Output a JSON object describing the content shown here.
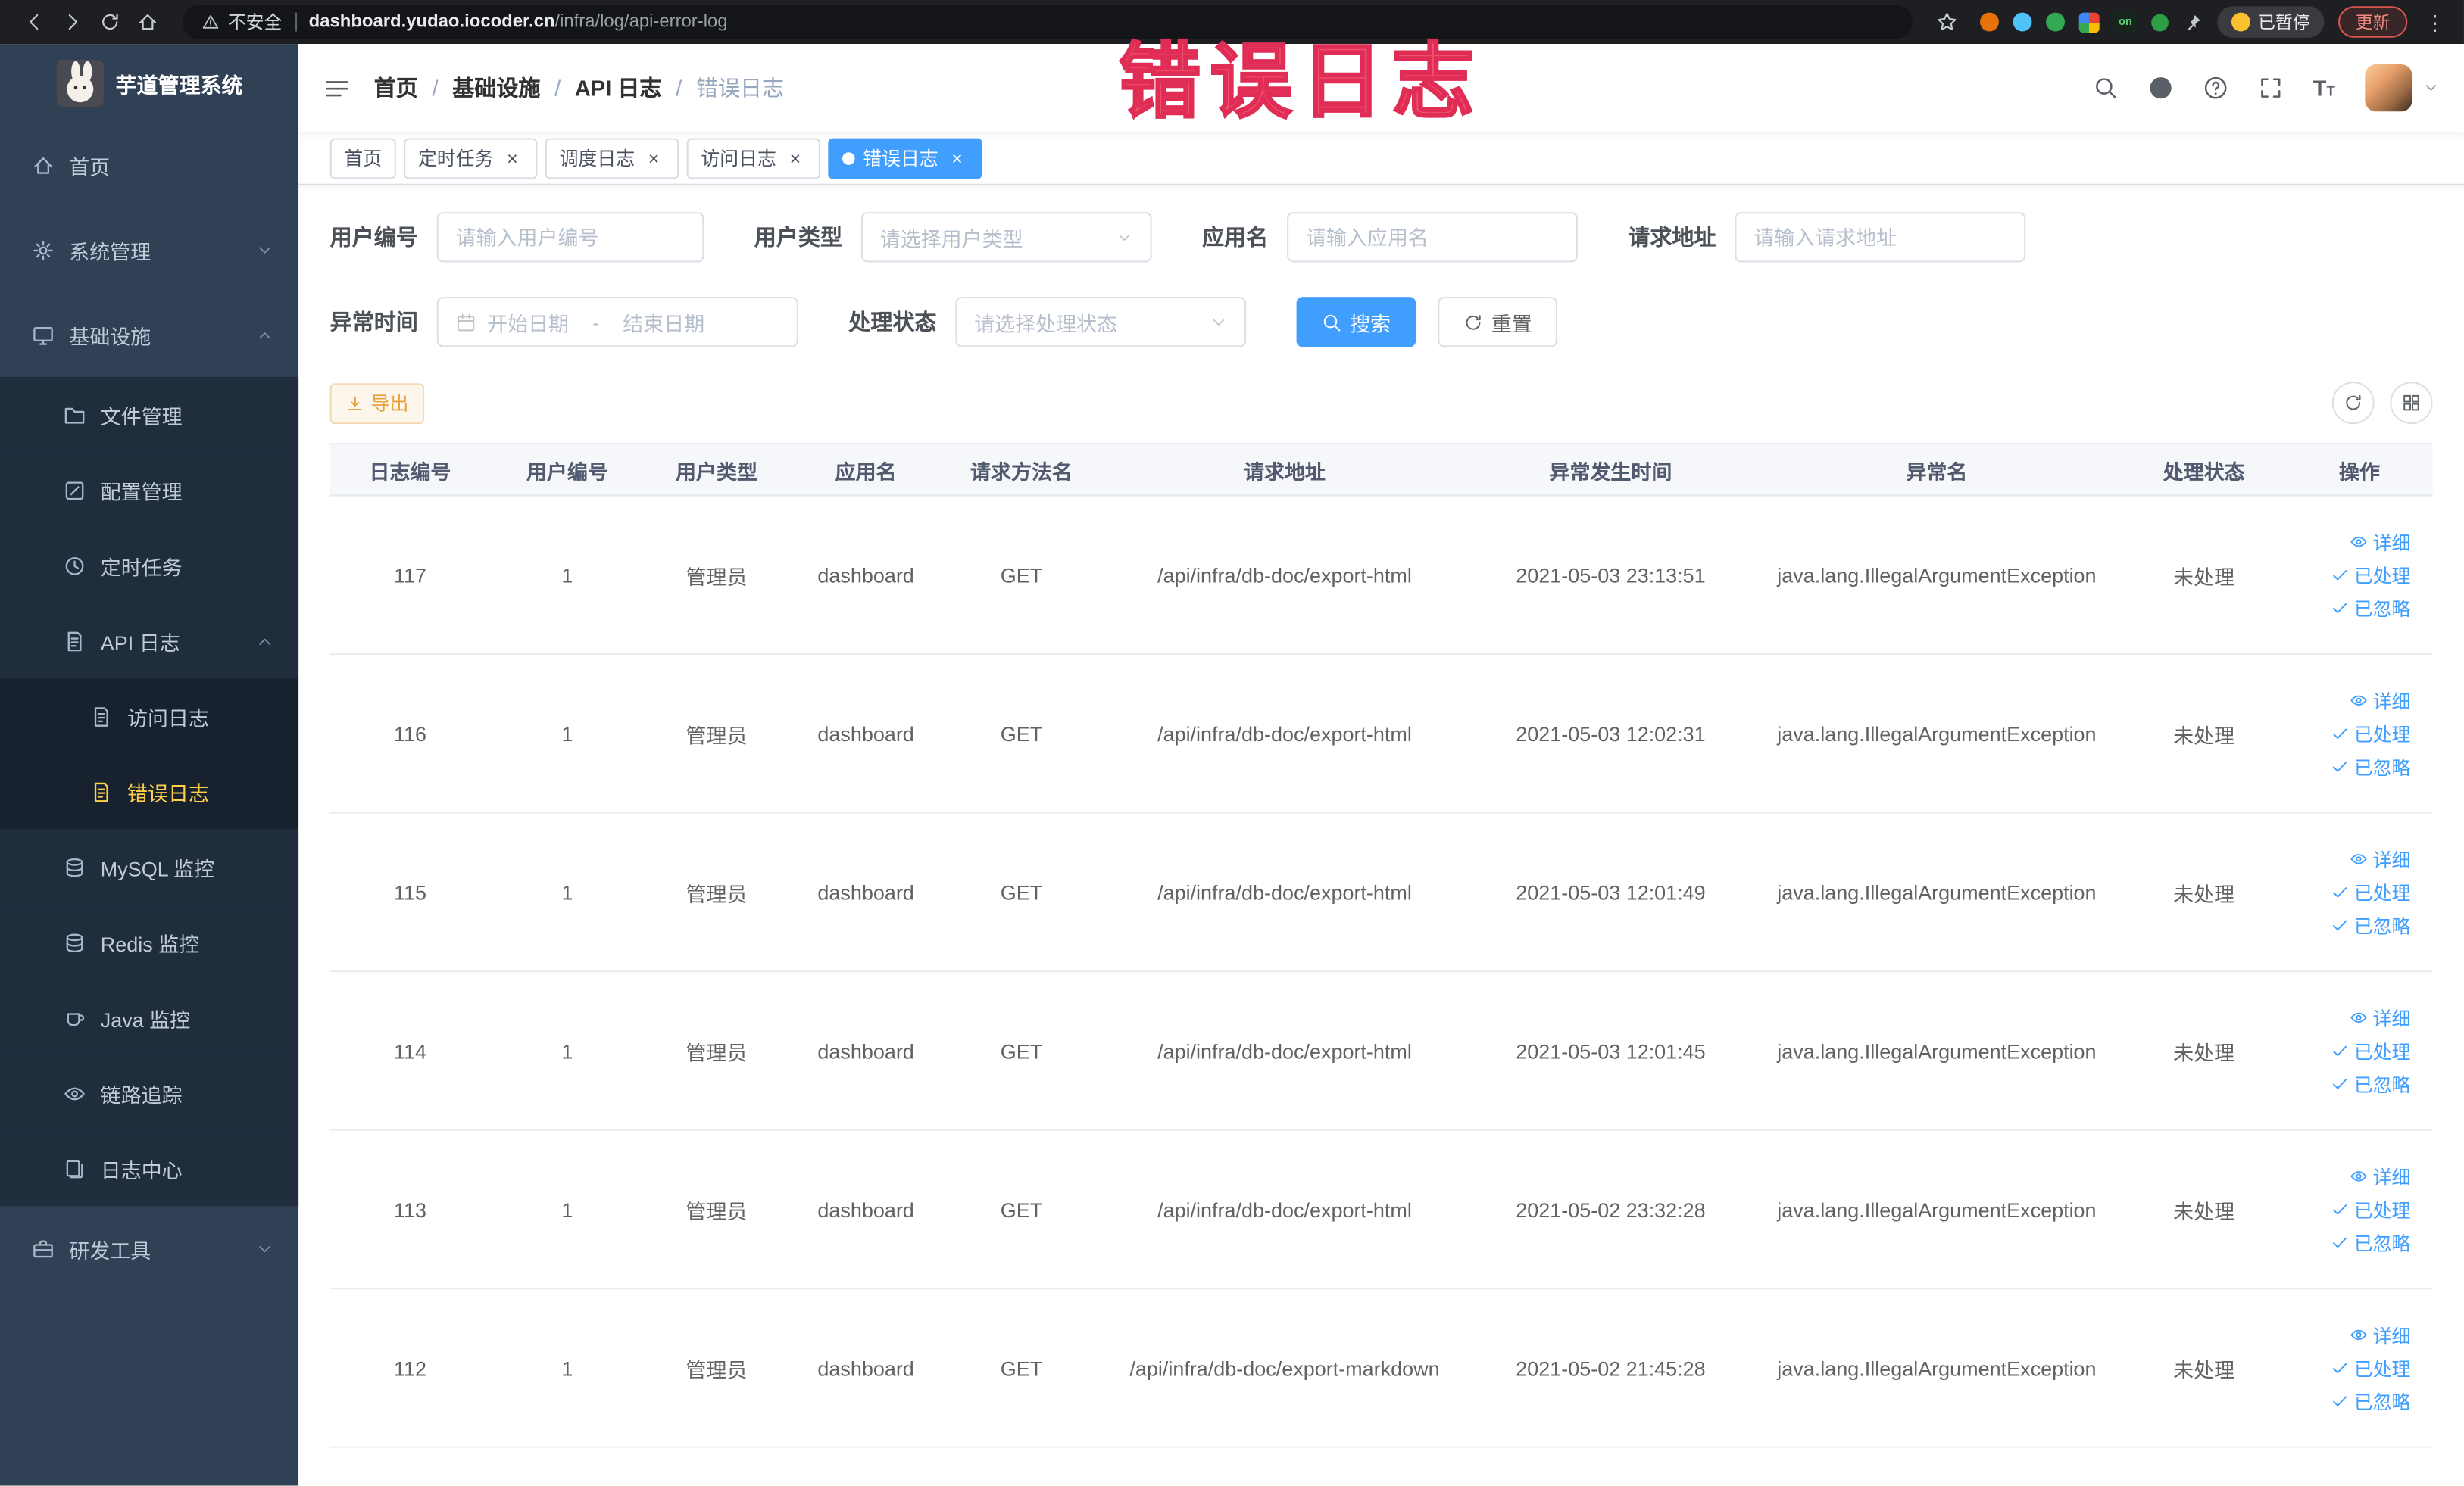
{
  "browser": {
    "security_label": "不安全",
    "url_domain": "dashboard.yudao.iocoder.cn",
    "url_path": "/infra/log/api-error-log",
    "extension_on_badge": "on",
    "paused_badge": "已暂停",
    "update_button": "更新"
  },
  "annotation": {
    "text": "错误日志"
  },
  "sidebar": {
    "logo_title": "芋道管理系统",
    "items": [
      {
        "label": "首页"
      },
      {
        "label": "系统管理"
      },
      {
        "label": "基础设施"
      },
      {
        "label": "文件管理"
      },
      {
        "label": "配置管理"
      },
      {
        "label": "定时任务"
      },
      {
        "label": "API 日志"
      },
      {
        "label": "访问日志"
      },
      {
        "label": "错误日志"
      },
      {
        "label": "MySQL 监控"
      },
      {
        "label": "Redis 监控"
      },
      {
        "label": "Java 监控"
      },
      {
        "label": "链路追踪"
      },
      {
        "label": "日志中心"
      },
      {
        "label": "研发工具"
      }
    ]
  },
  "header": {
    "breadcrumb_separator": "/",
    "breadcrumb": [
      {
        "label": "首页"
      },
      {
        "label": "基础设施"
      },
      {
        "label": "API 日志"
      },
      {
        "label": "错误日志"
      }
    ]
  },
  "tabs": [
    {
      "label": "首页"
    },
    {
      "label": "定时任务"
    },
    {
      "label": "调度日志"
    },
    {
      "label": "访问日志"
    },
    {
      "label": "错误日志"
    }
  ],
  "filters": {
    "user_id_label": "用户编号",
    "user_id_placeholder": "请输入用户编号",
    "user_type_label": "用户类型",
    "user_type_placeholder": "请选择用户类型",
    "app_name_label": "应用名",
    "app_name_placeholder": "请输入应用名",
    "request_url_label": "请求地址",
    "request_url_placeholder": "请输入请求地址",
    "exception_time_label": "异常时间",
    "start_date_placeholder": "开始日期",
    "range_separator": "-",
    "end_date_placeholder": "结束日期",
    "process_status_label": "处理状态",
    "process_status_placeholder": "请选择处理状态",
    "search_button": "搜索",
    "reset_button": "重置"
  },
  "toolbar": {
    "export_button": "导出"
  },
  "table": {
    "headers": [
      "日志编号",
      "用户编号",
      "用户类型",
      "应用名",
      "请求方法名",
      "请求地址",
      "异常发生时间",
      "异常名",
      "处理状态",
      "操作"
    ],
    "actions": [
      {
        "label": "详细"
      },
      {
        "label": "已处理"
      },
      {
        "label": "已忽略"
      }
    ],
    "rows": [
      {
        "id": "117",
        "user_id": "1",
        "user_type": "管理员",
        "app": "dashboard",
        "method": "GET",
        "url": "/api/infra/db-doc/export-html",
        "time": "2021-05-03 23:13:51",
        "exception": "java.lang.IllegalArgumentException",
        "status": "未处理"
      },
      {
        "id": "116",
        "user_id": "1",
        "user_type": "管理员",
        "app": "dashboard",
        "method": "GET",
        "url": "/api/infra/db-doc/export-html",
        "time": "2021-05-03 12:02:31",
        "exception": "java.lang.IllegalArgumentException",
        "status": "未处理"
      },
      {
        "id": "115",
        "user_id": "1",
        "user_type": "管理员",
        "app": "dashboard",
        "method": "GET",
        "url": "/api/infra/db-doc/export-html",
        "time": "2021-05-03 12:01:49",
        "exception": "java.lang.IllegalArgumentException",
        "status": "未处理"
      },
      {
        "id": "114",
        "user_id": "1",
        "user_type": "管理员",
        "app": "dashboard",
        "method": "GET",
        "url": "/api/infra/db-doc/export-html",
        "time": "2021-05-03 12:01:45",
        "exception": "java.lang.IllegalArgumentException",
        "status": "未处理"
      },
      {
        "id": "113",
        "user_id": "1",
        "user_type": "管理员",
        "app": "dashboard",
        "method": "GET",
        "url": "/api/infra/db-doc/export-html",
        "time": "2021-05-02 23:32:28",
        "exception": "java.lang.IllegalArgumentException",
        "status": "未处理"
      },
      {
        "id": "112",
        "user_id": "1",
        "user_type": "管理员",
        "app": "dashboard",
        "method": "GET",
        "url": "/api/infra/db-doc/export-markdown",
        "time": "2021-05-02 21:45:28",
        "exception": "java.lang.IllegalArgumentException",
        "status": "未处理"
      }
    ]
  },
  "colors": {
    "primary": "#409eff",
    "sidebar_bg": "#304156",
    "submenu_bg": "#1f2d3d",
    "active_menu_text": "#ffd04b",
    "warning": "#e6a23c",
    "annotation": "#f1506e"
  }
}
